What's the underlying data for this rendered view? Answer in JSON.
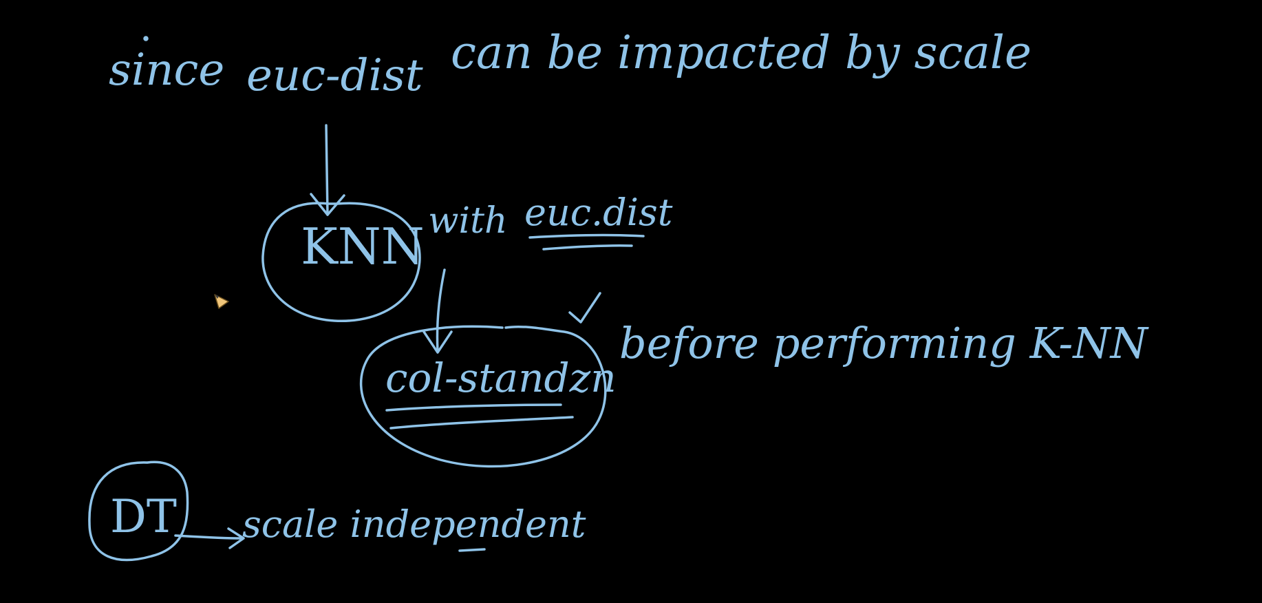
{
  "ink_color": "#8fc3e8",
  "background_color": "#000000",
  "notes": {
    "line1_since": "since",
    "line1_euc_dist": "euc-dist",
    "line1_rest": "can be impacted by scale",
    "knn": "KNN",
    "with": "with",
    "euc_dist": "euc.dist",
    "col_standz": "col-standzn",
    "before_performing": "before performing K-NN",
    "dt": "DT",
    "scale_independent": "scale independent"
  },
  "cursor_icon": "pencil-icon"
}
